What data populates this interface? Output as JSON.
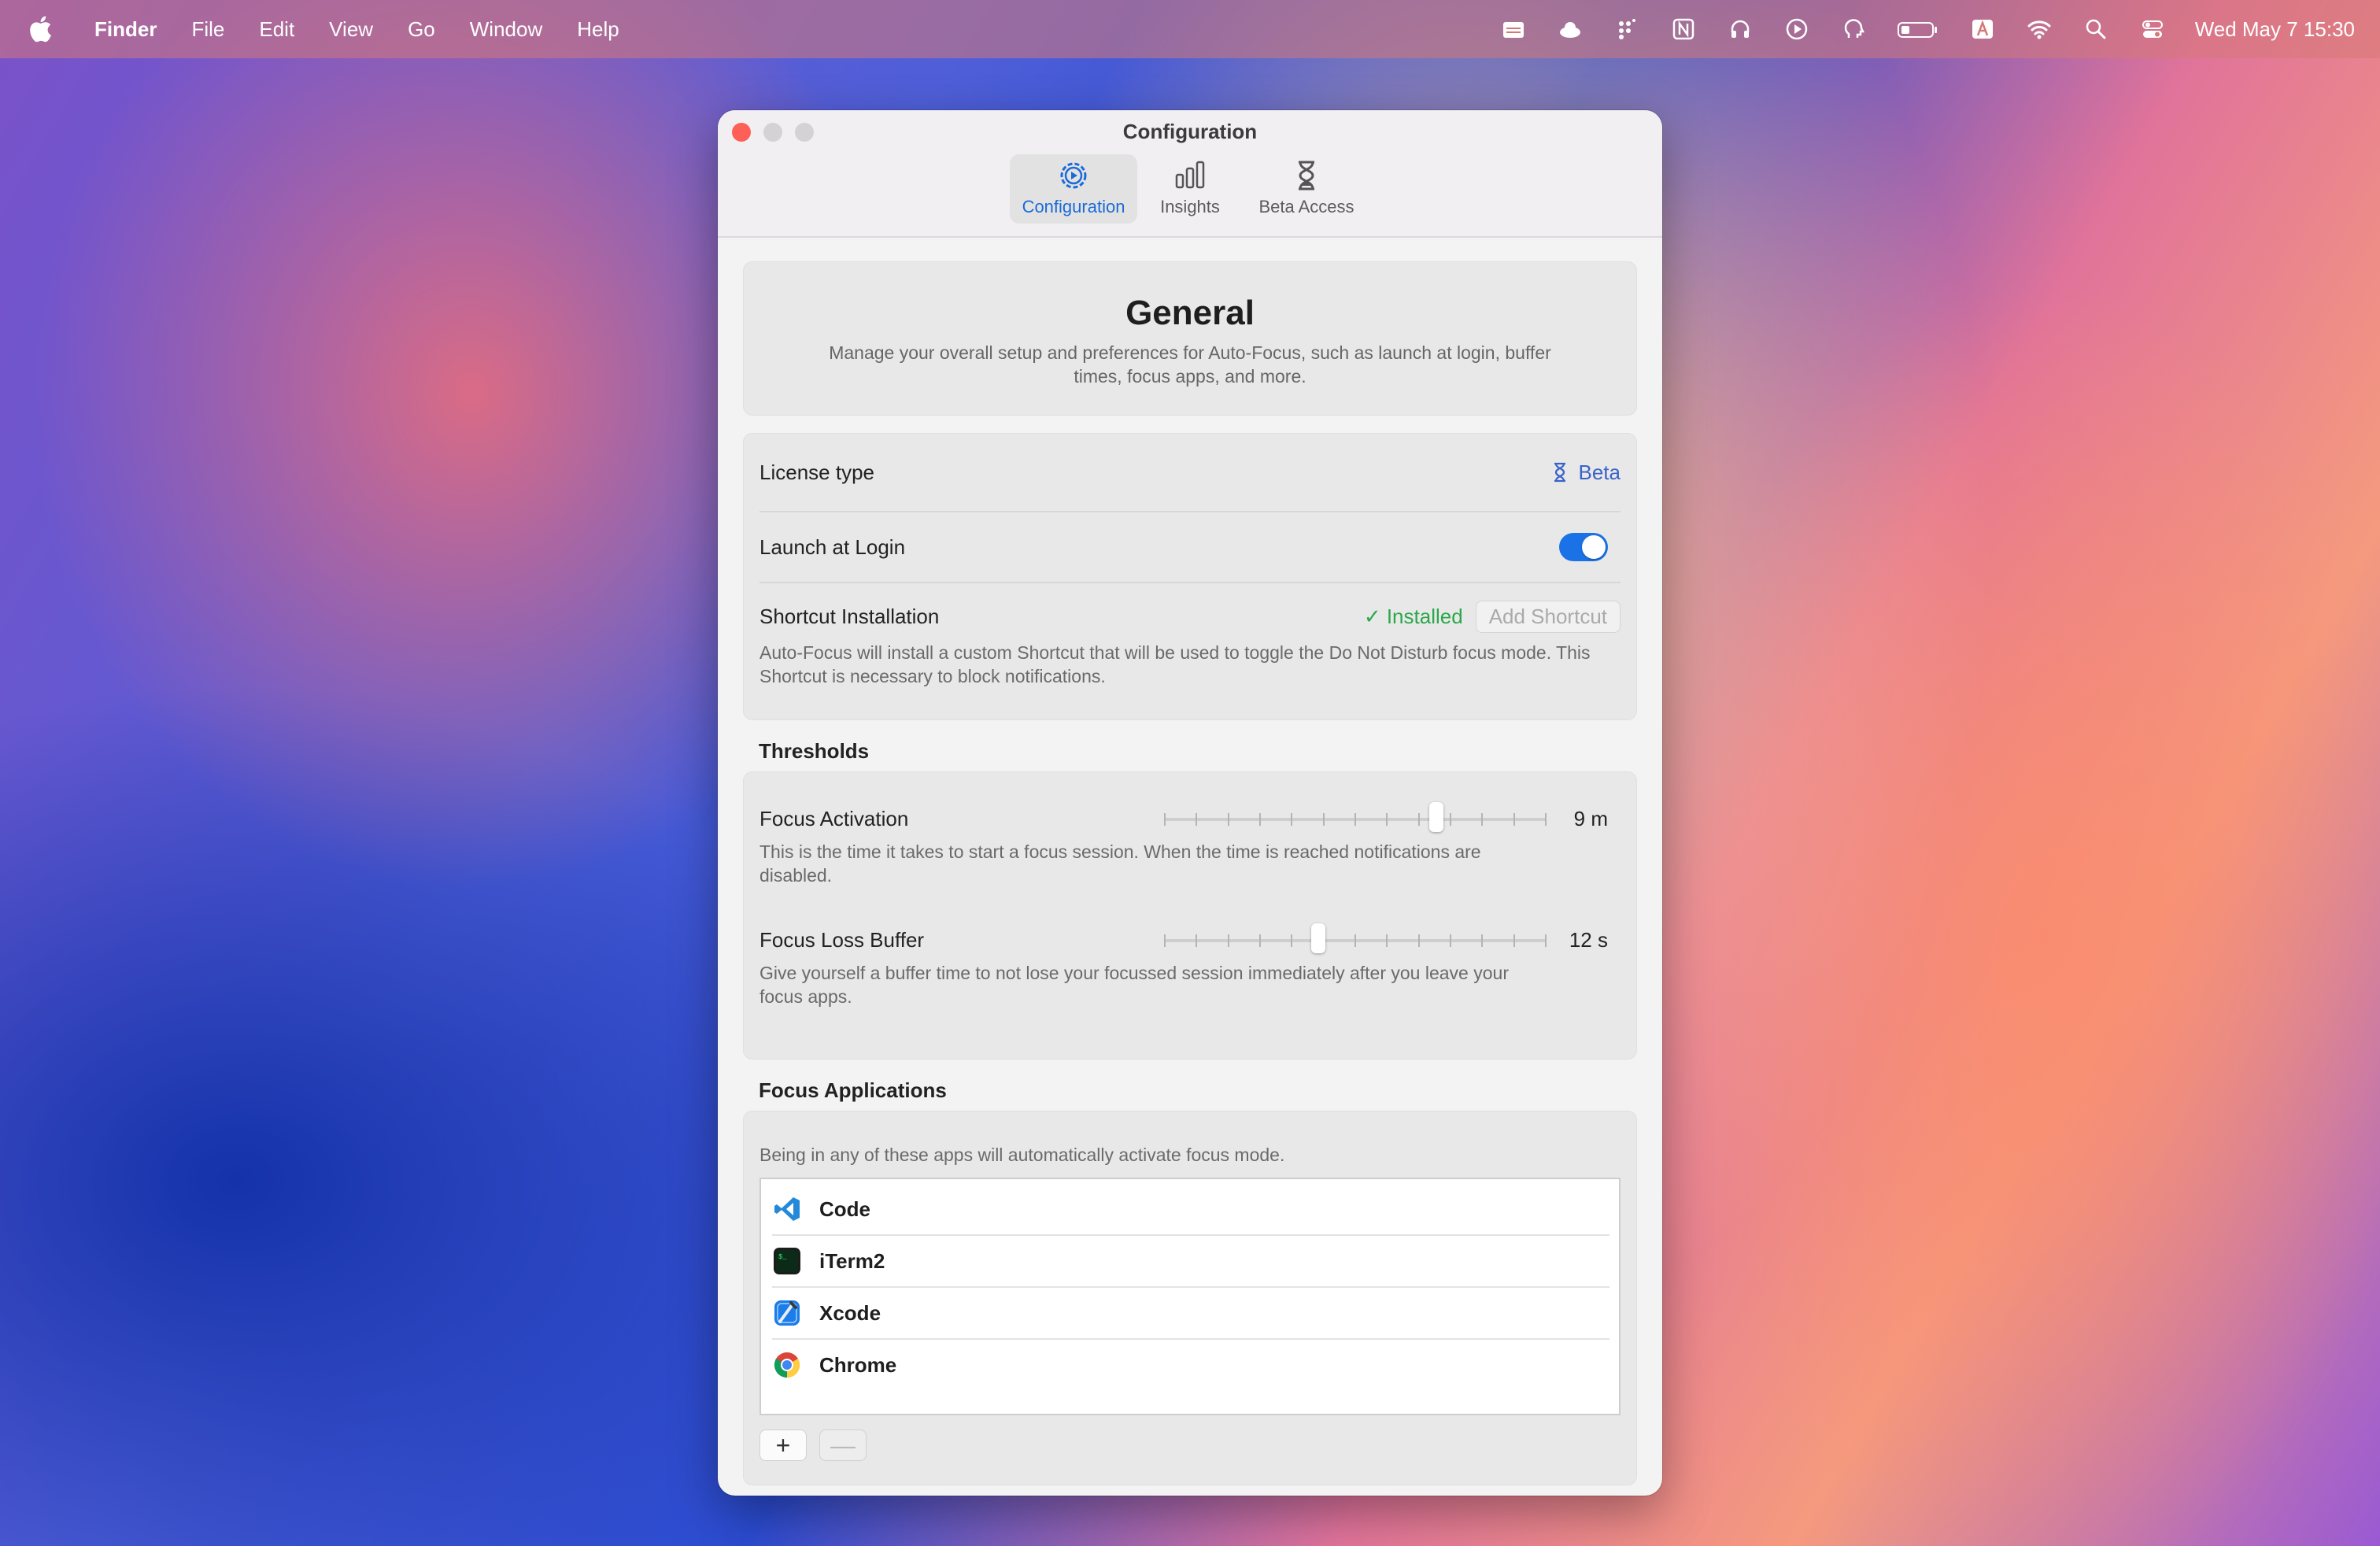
{
  "menubar": {
    "app_name": "Finder",
    "menus": [
      "File",
      "Edit",
      "View",
      "Go",
      "Window",
      "Help"
    ],
    "clock": "Wed May 7  15:30"
  },
  "window": {
    "title": "Configuration",
    "tabs": [
      {
        "label": "Configuration",
        "icon": "gear-icon",
        "active": true
      },
      {
        "label": "Insights",
        "icon": "bar-chart-icon",
        "active": false
      },
      {
        "label": "Beta Access",
        "icon": "hourglass-icon",
        "active": false
      }
    ]
  },
  "general": {
    "title": "General",
    "description": "Manage your overall setup and preferences for Auto-Focus, such as launch at login, buffer times, focus apps, and more."
  },
  "settings": {
    "license_label": "License type",
    "license_value": "Beta",
    "launch_label": "Launch at Login",
    "launch_enabled": true,
    "shortcut_label": "Shortcut Installation",
    "shortcut_status": "✓ Installed",
    "shortcut_button": "Add Shortcut",
    "shortcut_desc": "Auto-Focus will install a custom Shortcut that will be used to toggle the Do Not Disturb focus mode. This Shortcut is necessary to block notifications."
  },
  "thresholds": {
    "title": "Thresholds",
    "activation_label": "Focus Activation",
    "activation_value": "9 m",
    "activation_fraction": 0.72,
    "activation_desc": "This is the time it takes to start a focus session. When the time is reached notifications are disabled.",
    "buffer_label": "Focus Loss Buffer",
    "buffer_value": "12 s",
    "buffer_fraction": 0.4,
    "buffer_desc": "Give yourself a buffer time to not lose your focussed session immediately after you leave your focus apps."
  },
  "focus_apps": {
    "title": "Focus Applications",
    "description": "Being in any of these apps will automatically activate focus mode.",
    "apps": [
      {
        "name": "Code",
        "icon": "vscode-icon"
      },
      {
        "name": "iTerm2",
        "icon": "iterm-icon"
      },
      {
        "name": "Xcode",
        "icon": "xcode-icon"
      },
      {
        "name": "Chrome",
        "icon": "chrome-icon"
      }
    ],
    "add_button": "+",
    "remove_button": "—"
  },
  "colors": {
    "accent": "#1a72e6",
    "installed_green": "#2aa84a",
    "beta_blue": "#3a63c9"
  }
}
